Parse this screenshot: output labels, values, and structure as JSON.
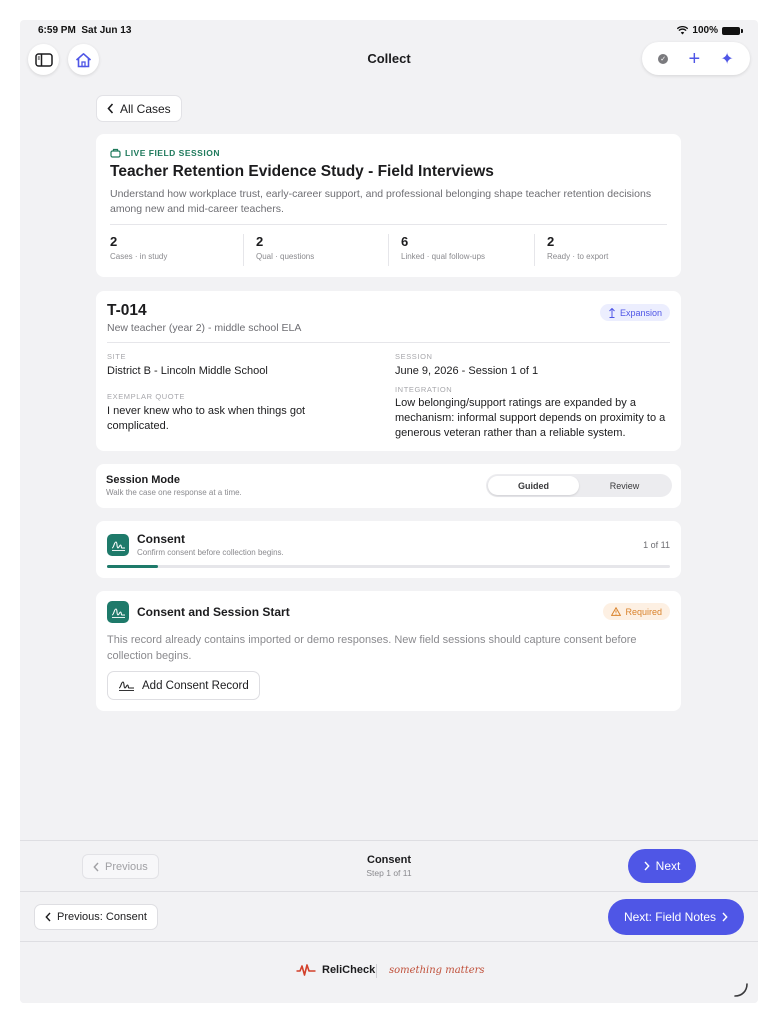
{
  "status": {
    "time": "6:59 PM",
    "date": "Sat Jun 13",
    "battery": "100%"
  },
  "nav": {
    "title": "Collect"
  },
  "back": {
    "label": "All Cases"
  },
  "study": {
    "tag": "LIVE FIELD SESSION",
    "title": "Teacher Retention Evidence Study - Field Interviews",
    "description": "Understand how workplace trust, early-career support, and professional belonging shape teacher retention decisions among new and mid-career teachers.",
    "stats": [
      {
        "value": "2",
        "label": "Cases · in study"
      },
      {
        "value": "2",
        "label": "Qual · questions"
      },
      {
        "value": "6",
        "label": "Linked · qual follow-ups"
      },
      {
        "value": "2",
        "label": "Ready · to export"
      }
    ]
  },
  "case": {
    "id": "T-014",
    "subtitle": "New teacher (year 2) - middle school ELA",
    "badge": "Expansion",
    "site_label": "SITE",
    "site": "District B - Lincoln Middle School",
    "session_label": "SESSION",
    "session": "June 9, 2026 - Session 1 of 1",
    "quote_label": "EXEMPLAR QUOTE",
    "quote": "I never knew who to ask when things got complicated.",
    "integration_label": "INTEGRATION",
    "integration": "Low belonging/support ratings are expanded by a mechanism: informal support depends on proximity to a generous veteran rather than a reliable system."
  },
  "session_mode": {
    "title": "Session Mode",
    "subtitle": "Walk the case one response at a time.",
    "options": [
      "Guided",
      "Review"
    ],
    "selected": "Guided"
  },
  "progress_card": {
    "title": "Consent",
    "subtitle": "Confirm consent before collection begins.",
    "count": "1 of 11",
    "fraction": 0.09
  },
  "consent_card": {
    "title": "Consent and Session Start",
    "badge": "Required",
    "body": "This record already contains imported or demo responses. New field sessions should capture consent before collection begins.",
    "button": "Add Consent Record"
  },
  "step_nav": {
    "previous": "Previous",
    "title": "Consent",
    "subtitle": "Step 1 of 11",
    "next": "Next"
  },
  "section_nav": {
    "previous": "Previous: Consent",
    "next": "Next: Field Notes"
  },
  "footer": {
    "brand": "ReliCheck",
    "tagline": "something matters"
  },
  "colors": {
    "accent": "#4f56e6",
    "teal": "#1e7a6a",
    "warning": "#d9822b",
    "brand_red": "#c0503a"
  }
}
